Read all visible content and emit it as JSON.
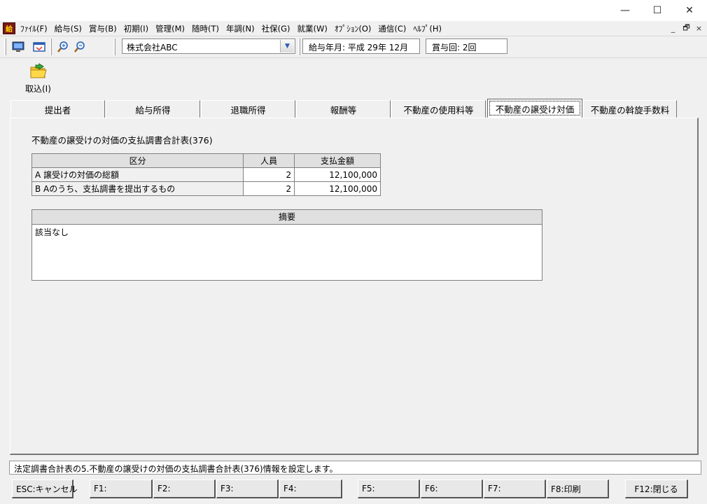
{
  "window": {
    "minimize": "—",
    "maximize": "☐",
    "close": "✕"
  },
  "menu": [
    "ﾌｧｲﾙ(F)",
    "給与(S)",
    "賞与(B)",
    "初期(I)",
    "管理(M)",
    "随時(T)",
    "年調(N)",
    "社保(G)",
    "就業(W)",
    "ｵﾌﾟｼｮﾝ(O)",
    "通信(C)",
    "ﾍﾙﾌﾟ(H)"
  ],
  "mdi": {
    "minimize": "_",
    "restore": "🗗",
    "close": "×"
  },
  "toolbar": {
    "company": "株式会社ABC",
    "pay_month": "給与年月: 平成 29年 12月",
    "bonus_count": "賞与回: 2回"
  },
  "import_button": {
    "label": "取込(I)"
  },
  "tabs": [
    {
      "label": "提出者"
    },
    {
      "label": "給与所得"
    },
    {
      "label": "退職所得"
    },
    {
      "label": "報酬等"
    },
    {
      "label": "不動産の使用料等"
    },
    {
      "label": "不動産の譲受け対価",
      "active": true
    },
    {
      "label": "不動産の斡旋手数料"
    }
  ],
  "section_title": "不動産の譲受けの対価の支払調書合計表(376)",
  "summary_table": {
    "headers": [
      "区分",
      "人員",
      "支払金額"
    ],
    "rows": [
      [
        "A 譲受けの対価の総額",
        "2",
        "12,100,000"
      ],
      [
        "B Aのうち、支払調書を提出するもの",
        "2",
        "12,100,000"
      ]
    ]
  },
  "memo": {
    "header": "摘要",
    "text": "該当なし"
  },
  "status": "法定調書合計表の5.不動産の譲受けの対価の支払調書合計表(376)情報を設定します。",
  "fkeys": [
    "ESC:キャンセル",
    "F1:",
    "F2:",
    "F3:",
    "F4:",
    "F5:",
    "F6:",
    "F7:",
    "F8:印刷",
    "F12:閉じる"
  ],
  "colors": {
    "accent_icon": "#2a5db0",
    "app_icon": "#7a1a1a"
  }
}
